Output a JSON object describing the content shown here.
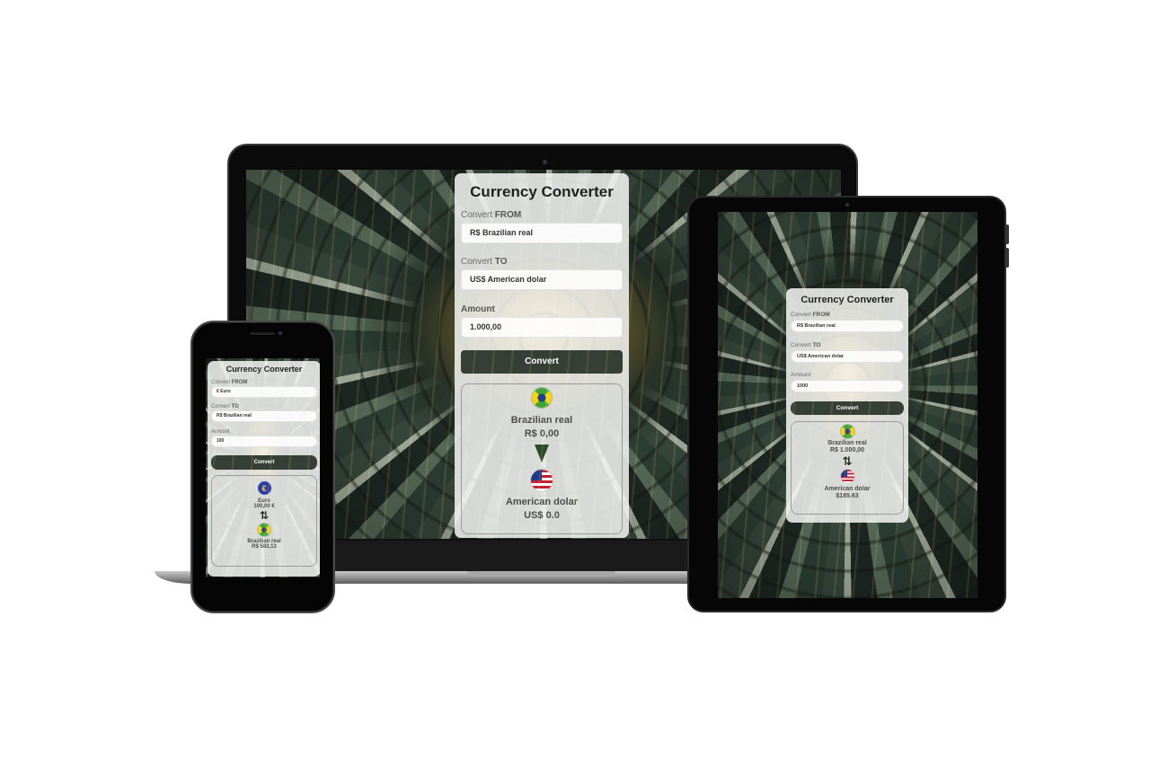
{
  "laptop": {
    "title": "Currency Converter",
    "from_label_prefix": "Convert",
    "from_label_strong": "FROM",
    "from_value": "R$ Brazilian real",
    "to_label_prefix": "Convert",
    "to_label_strong": "TO",
    "to_value": "US$ American dolar",
    "amount_label": "Amount",
    "amount_value": "1.000,00",
    "convert_label": "Convert",
    "result_from_name": "Brazilian real",
    "result_from_value": "R$ 0,00",
    "result_to_name": "American dolar",
    "result_to_value": "US$ 0.0",
    "from_icon": "brazil-flag-icon",
    "to_icon": "usa-flag-icon",
    "arrow_icon": "arrow-down-icon"
  },
  "tablet": {
    "title": "Currency Converter",
    "from_label_prefix": "Convert",
    "from_label_strong": "FROM",
    "from_value": "R$ Brazilian real",
    "to_label_prefix": "Convert",
    "to_label_strong": "TO",
    "to_value": "US$ American dolar",
    "amount_label": "Amount",
    "amount_value": "1000",
    "convert_label": "Convert",
    "result_from_name": "Brazilian real",
    "result_from_value": "R$ 1.000,00",
    "swap_glyph": "⇅",
    "result_to_name": "American dolar",
    "result_to_value": "$185.63",
    "from_icon": "brazil-flag-icon",
    "to_icon": "usa-flag-icon"
  },
  "phone": {
    "title": "Currency Converter",
    "from_label_prefix": "Convert",
    "from_label_strong": "FROM",
    "from_value": "€ Euro",
    "to_label_prefix": "Convert",
    "to_label_strong": "TO",
    "to_value": "R$ Brazilian real",
    "amount_label": "Amount",
    "amount_value": "100",
    "convert_label": "Convert",
    "euro_glyph": "€",
    "result_from_name": "Euro",
    "result_from_value": "100,00 €",
    "swap_glyph": "⇅",
    "result_to_name": "Brazilian real",
    "result_to_value": "R$ 583,13",
    "from_icon": "euro-flag-icon",
    "to_icon": "brazil-flag-icon"
  },
  "colors": {
    "button": "#363f36",
    "arrow": "#284c26",
    "card": "#f4f6f3"
  }
}
